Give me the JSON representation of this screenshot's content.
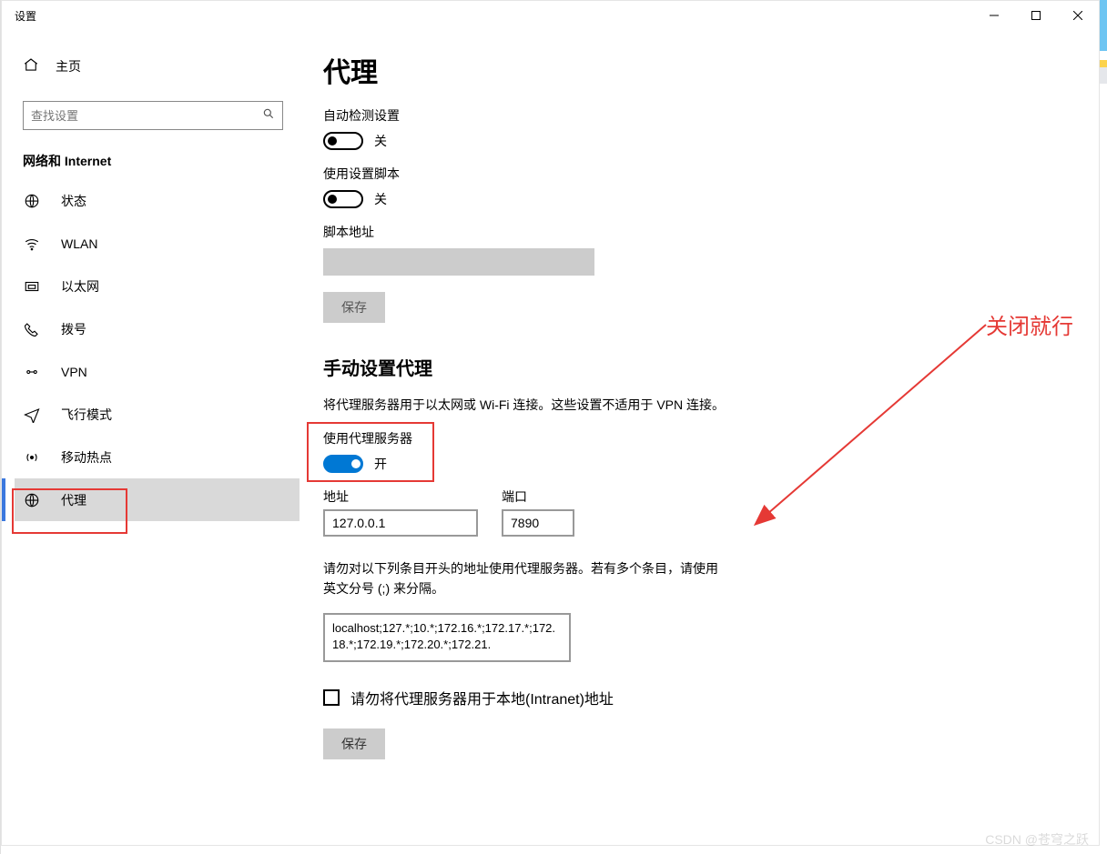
{
  "window": {
    "title": "设置"
  },
  "sidebar": {
    "home": "主页",
    "search_placeholder": "查找设置",
    "section": "网络和 Internet",
    "items": [
      {
        "icon": "status",
        "label": "状态"
      },
      {
        "icon": "wlan",
        "label": "WLAN"
      },
      {
        "icon": "ethernet",
        "label": "以太网"
      },
      {
        "icon": "dialup",
        "label": "拨号"
      },
      {
        "icon": "vpn",
        "label": "VPN"
      },
      {
        "icon": "airplane",
        "label": "飞行模式"
      },
      {
        "icon": "hotspot",
        "label": "移动热点"
      },
      {
        "icon": "proxy",
        "label": "代理"
      }
    ]
  },
  "main": {
    "title": "代理",
    "auto_detect_label": "自动检测设置",
    "auto_detect_state": "关",
    "script_label": "使用设置脚本",
    "script_state": "关",
    "script_addr_label": "脚本地址",
    "save_btn": "保存",
    "manual_header": "手动设置代理",
    "manual_desc": "将代理服务器用于以太网或 Wi-Fi 连接。这些设置不适用于 VPN 连接。",
    "use_proxy_label": "使用代理服务器",
    "use_proxy_state": "开",
    "addr_label": "地址",
    "addr_value": "127.0.0.1",
    "port_label": "端口",
    "port_value": "7890",
    "exclude_desc": "请勿对以下列条目开头的地址使用代理服务器。若有多个条目，请使用英文分号 (;) 来分隔。",
    "exclude_value": "localhost;127.*;10.*;172.16.*;172.17.*;172.18.*;172.19.*;172.20.*;172.21.",
    "chk_label": "请勿将代理服务器用于本地(Intranet)地址",
    "save_btn2": "保存"
  },
  "annotation": "关闭就行",
  "watermark": "CSDN @苍穹之跃"
}
